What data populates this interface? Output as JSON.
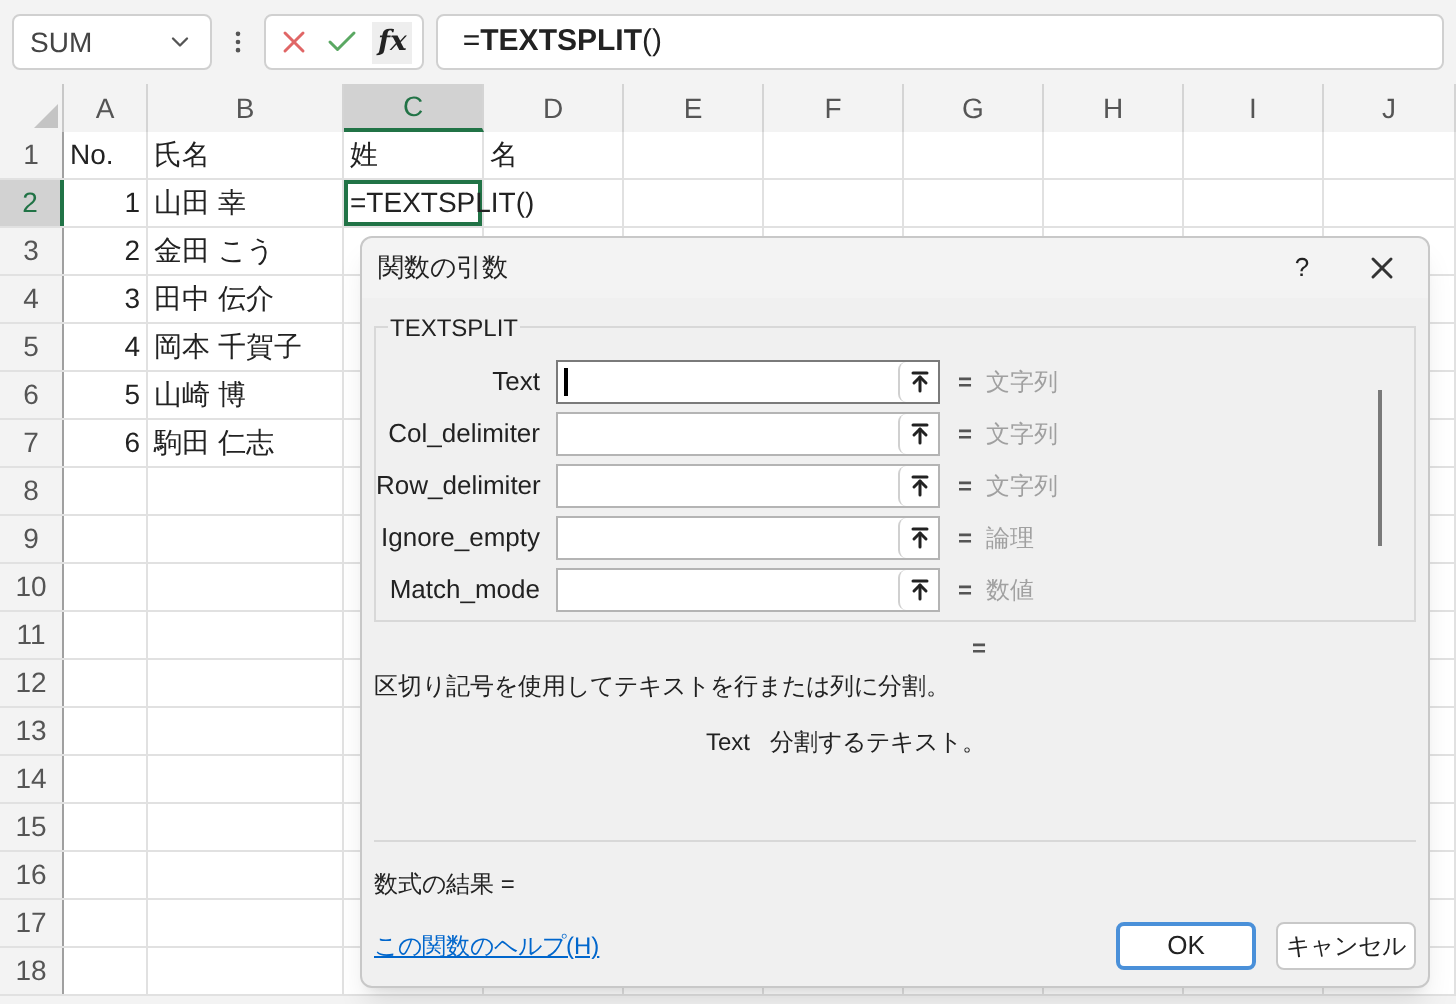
{
  "formula_bar": {
    "name_box": "SUM",
    "fx": "fx",
    "formula": "=**TEXTSPLIT**()"
  },
  "columns": [
    {
      "label": "A",
      "selected": false
    },
    {
      "label": "B",
      "selected": false
    },
    {
      "label": "C",
      "selected": true
    },
    {
      "label": "D",
      "selected": false
    },
    {
      "label": "E",
      "selected": false
    },
    {
      "label": "F",
      "selected": false
    },
    {
      "label": "G",
      "selected": false
    },
    {
      "label": "H",
      "selected": false
    },
    {
      "label": "I",
      "selected": false
    },
    {
      "label": "J",
      "selected": false
    }
  ],
  "rows": [
    {
      "header": "1",
      "selected": false,
      "cells": [
        {
          "kind": "text",
          "text": "No."
        },
        {
          "kind": "text",
          "text": "氏名"
        },
        {
          "kind": "text",
          "text": "姓"
        },
        {
          "kind": "text",
          "text": "名"
        }
      ]
    },
    {
      "header": "2",
      "selected": true,
      "cells": [
        {
          "kind": "number",
          "text": "1"
        },
        {
          "kind": "text",
          "text": "山田 幸"
        },
        {
          "kind": "text",
          "text": "=TEXTSPLIT()"
        }
      ]
    },
    {
      "header": "3",
      "selected": false,
      "cells": [
        {
          "kind": "number",
          "text": "2"
        },
        {
          "kind": "text",
          "text": "金田 こう"
        }
      ]
    },
    {
      "header": "4",
      "selected": false,
      "cells": [
        {
          "kind": "number",
          "text": "3"
        },
        {
          "kind": "text",
          "text": "田中 伝介"
        }
      ]
    },
    {
      "header": "5",
      "selected": false,
      "cells": [
        {
          "kind": "number",
          "text": "4"
        },
        {
          "kind": "text",
          "text": "岡本 千賀子"
        }
      ]
    },
    {
      "header": "6",
      "selected": false,
      "cells": [
        {
          "kind": "number",
          "text": "5"
        },
        {
          "kind": "text",
          "text": "山崎 博"
        }
      ]
    },
    {
      "header": "7",
      "selected": false,
      "cells": [
        {
          "kind": "number",
          "text": "6"
        },
        {
          "kind": "text",
          "text": "駒田 仁志"
        }
      ]
    },
    {
      "header": "8",
      "selected": false
    },
    {
      "header": "9",
      "selected": false
    },
    {
      "header": "10",
      "selected": false
    },
    {
      "header": "11",
      "selected": false
    },
    {
      "header": "12",
      "selected": false
    },
    {
      "header": "13",
      "selected": false
    },
    {
      "header": "14",
      "selected": false
    },
    {
      "header": "15",
      "selected": false
    },
    {
      "header": "16",
      "selected": false
    },
    {
      "header": "17",
      "selected": false
    },
    {
      "header": "18",
      "selected": false
    }
  ],
  "dialog": {
    "title": "関数の引数",
    "help": "?",
    "function_name": "TEXTSPLIT",
    "arguments": [
      {
        "label": "Text",
        "focused": true,
        "equals": "=",
        "result": "文字列"
      },
      {
        "label": "Col_delimiter",
        "focused": false,
        "equals": "=",
        "result": "文字列"
      },
      {
        "label": "Row_delimiter",
        "focused": false,
        "equals": "=",
        "result": "文字列"
      },
      {
        "label": "Ignore_empty",
        "focused": false,
        "equals": "=",
        "result": "論理"
      },
      {
        "label": "Match_mode",
        "focused": false,
        "equals": "=",
        "result": "数値"
      }
    ],
    "result_equals": "=",
    "description": "区切り記号を使用してテキストを行または列に分割。",
    "argument_help": {
      "name": "Text",
      "text": "分割するテキスト。"
    },
    "formula_result": "数式の結果 =",
    "help_link": "この関数のヘルプ(H)",
    "buttons": [
      {
        "label": "OK",
        "default": true
      },
      {
        "label": "キャンセル",
        "default": false
      }
    ]
  }
}
